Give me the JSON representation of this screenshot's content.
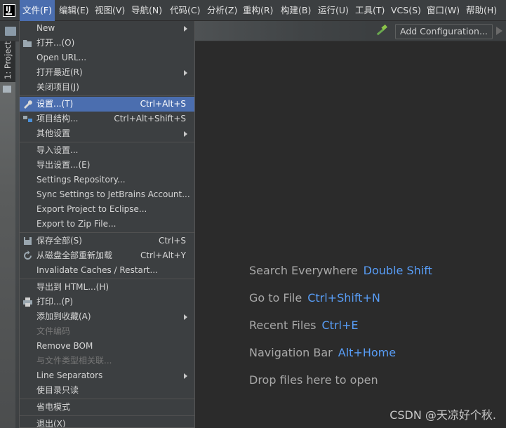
{
  "menubar": {
    "items": [
      "文件(F)",
      "编辑(E)",
      "视图(V)",
      "导航(N)",
      "代码(C)",
      "分析(Z)",
      "重构(R)",
      "构建(B)",
      "运行(U)",
      "工具(T)",
      "VCS(S)",
      "窗口(W)",
      "帮助(H)"
    ],
    "active_index": 0
  },
  "toolbar": {
    "add_configuration": "Add Configuration..."
  },
  "left_strip": {
    "project_tab": "1: Project"
  },
  "file_menu": {
    "items": [
      {
        "label": "New",
        "shortcut": "",
        "submenu": true
      },
      {
        "label": "打开...(O)",
        "shortcut": "",
        "icon": "folder-open-icon"
      },
      {
        "label": "Open URL...",
        "shortcut": ""
      },
      {
        "label": "打开最近(R)",
        "shortcut": "",
        "submenu": true
      },
      {
        "label": "关闭项目(J)",
        "shortcut": ""
      },
      {
        "label": "设置...(T)",
        "shortcut": "Ctrl+Alt+S",
        "icon": "wrench-icon",
        "highlighted": true
      },
      {
        "label": "项目结构...",
        "shortcut": "Ctrl+Alt+Shift+S",
        "icon": "project-structure-icon"
      },
      {
        "label": "其他设置",
        "shortcut": "",
        "submenu": true
      },
      {
        "label": "导入设置...",
        "shortcut": ""
      },
      {
        "label": "导出设置...(E)",
        "shortcut": ""
      },
      {
        "label": "Settings Repository...",
        "shortcut": ""
      },
      {
        "label": "Sync Settings to JetBrains Account...",
        "shortcut": ""
      },
      {
        "label": "Export Project to Eclipse...",
        "shortcut": ""
      },
      {
        "label": "Export to Zip File...",
        "shortcut": ""
      },
      {
        "label": "保存全部(S)",
        "shortcut": "Ctrl+S",
        "icon": "save-icon"
      },
      {
        "label": "从磁盘全部重新加载",
        "shortcut": "Ctrl+Alt+Y",
        "icon": "reload-icon"
      },
      {
        "label": "Invalidate Caches / Restart...",
        "shortcut": ""
      },
      {
        "label": "导出到 HTML...(H)",
        "shortcut": ""
      },
      {
        "label": "打印...(P)",
        "shortcut": "",
        "icon": "print-icon"
      },
      {
        "label": "添加到收藏(A)",
        "shortcut": "",
        "submenu": true
      },
      {
        "label": "文件编码",
        "shortcut": "",
        "disabled": true
      },
      {
        "label": "Remove BOM",
        "shortcut": ""
      },
      {
        "label": "与文件类型相关联...",
        "shortcut": "",
        "disabled": true
      },
      {
        "label": "Line Separators",
        "shortcut": "",
        "submenu": true
      },
      {
        "label": "使目录只读",
        "shortcut": ""
      },
      {
        "label": "省电模式",
        "shortcut": ""
      },
      {
        "label": "退出(X)",
        "shortcut": ""
      }
    ]
  },
  "hints": [
    {
      "text": "Search Everywhere",
      "key": "Double Shift"
    },
    {
      "text": "Go to File",
      "key": "Ctrl+Shift+N"
    },
    {
      "text": "Recent Files",
      "key": "Ctrl+E"
    },
    {
      "text": "Navigation Bar",
      "key": "Alt+Home"
    },
    {
      "text": "Drop files here to open",
      "key": ""
    }
  ],
  "watermark": "CSDN @天凉好个秋.",
  "colors": {
    "highlight": "#4b6eaf",
    "hint_key": "#589df6",
    "background": "#2b2b2b",
    "menu": "#3c3f41"
  }
}
